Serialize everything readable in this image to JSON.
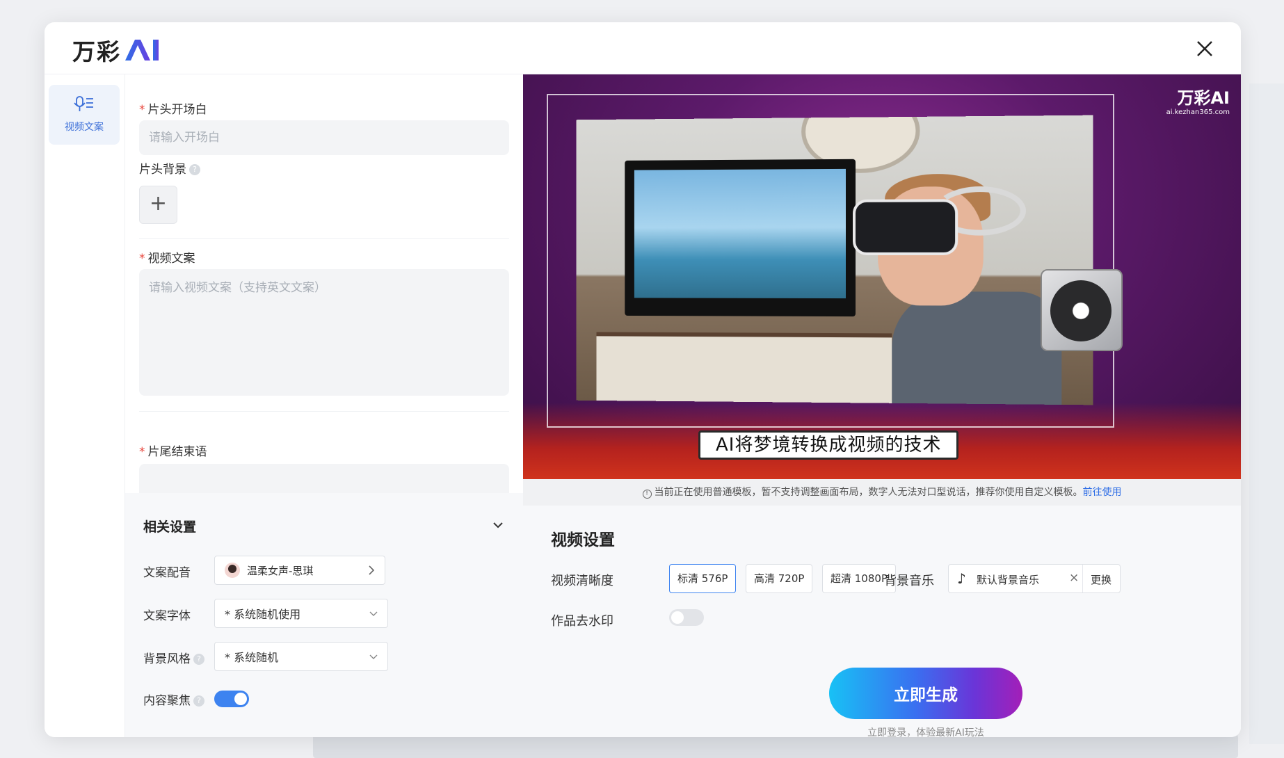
{
  "app": {
    "logo_text": "万彩",
    "logo_ai": "AI",
    "brand_color": "#2f6ee6"
  },
  "nav": {
    "items": [
      {
        "label": "视频文案",
        "icon": "mic-script-icon",
        "active": true
      }
    ]
  },
  "form": {
    "opening": {
      "label": "片头开场白",
      "required": true,
      "placeholder": "请输入开场白"
    },
    "opening_bg": {
      "label": "片头背景",
      "help": "?",
      "add": "+"
    },
    "script": {
      "label": "视频文案",
      "required": true,
      "placeholder": "请输入视频文案（支持英文文案）"
    },
    "ending": {
      "label": "片尾结束语",
      "required": true
    }
  },
  "related_settings": {
    "title": "相关设置",
    "voice": {
      "label": "文案配音",
      "value": "温柔女声-思琪"
    },
    "font": {
      "label": "文案字体",
      "value": "* 系统随机使用"
    },
    "bg_style": {
      "label": "背景风格",
      "value": "* 系统随机"
    },
    "focus": {
      "label": "内容聚焦",
      "enabled": true
    }
  },
  "preview": {
    "caption": "AI将梦境转换成视频的技术",
    "logo_main": "万彩AI",
    "logo_sub": "ai.kezhan365.com"
  },
  "notice": {
    "text": "当前正在使用普通模板，暂不支持调整画面布局，数字人无法对口型说话，推荐你使用自定义模板。",
    "link": "前往使用"
  },
  "video_settings": {
    "title": "视频设置",
    "resolution_label": "视频清晰度",
    "resolutions": [
      {
        "label": "标清 576P",
        "active": true
      },
      {
        "label": "高清 720P",
        "active": false
      },
      {
        "label": "超清 1080P",
        "active": false
      }
    ],
    "music_label": "背景音乐",
    "music_value": "默认背景音乐",
    "music_change": "更换",
    "watermark_label": "作品去水印",
    "watermark_enabled": false,
    "generate": "立即生成",
    "login_tip": "立即登录，体验最新AI玩法"
  }
}
